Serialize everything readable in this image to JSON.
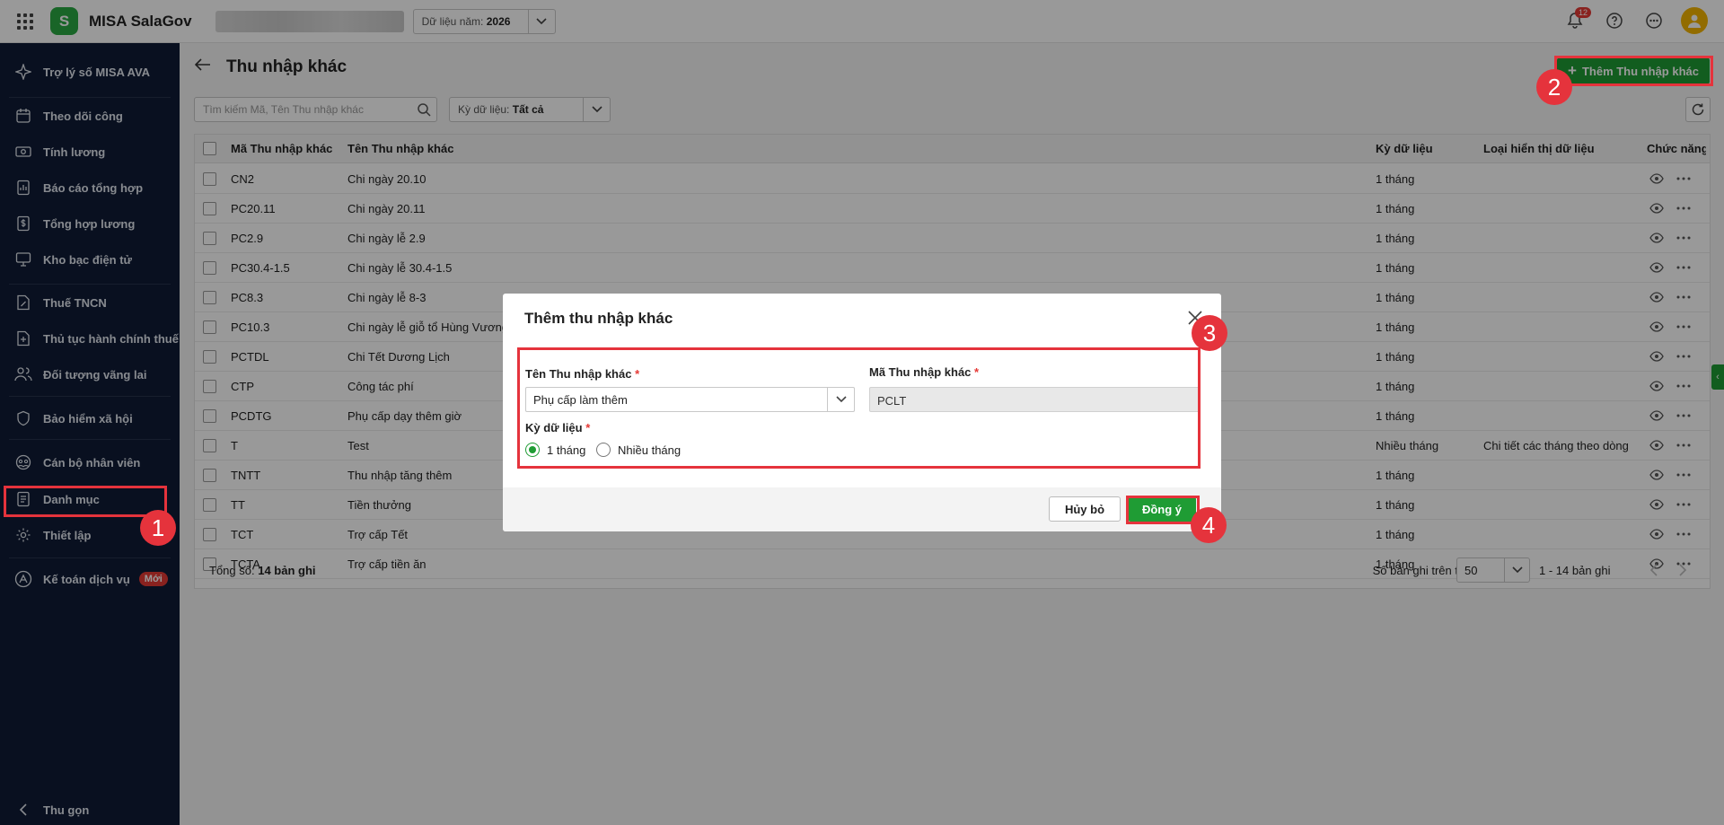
{
  "topbar": {
    "app_name": "MISA SalaGov",
    "logo_letter": "S",
    "year_label": "Dữ liệu năm:",
    "year_value": "2026",
    "notification_count": "12"
  },
  "sidebar": {
    "items": [
      {
        "label": "Trợ lý số MISA AVA",
        "icon": "sparkle-icon"
      },
      {
        "label": "Theo dõi công",
        "icon": "calendar-icon"
      },
      {
        "label": "Tính lương",
        "icon": "money-icon"
      },
      {
        "label": "Báo cáo tổng hợp",
        "icon": "report-icon"
      },
      {
        "label": "Tổng hợp lương",
        "icon": "salary-summary-icon"
      },
      {
        "label": "Kho bạc điện tử",
        "icon": "monitor-icon"
      },
      {
        "label": "Thuế TNCN",
        "icon": "tax-icon"
      },
      {
        "label": "Thủ tục hành chính thuế",
        "icon": "document-add-icon"
      },
      {
        "label": "Đối tượng vãng lai",
        "icon": "users-icon"
      },
      {
        "label": "Bảo hiểm xã hội",
        "icon": "shield-icon"
      },
      {
        "label": "Cán bộ nhân viên",
        "icon": "staff-icon"
      },
      {
        "label": "Danh mục",
        "icon": "list-icon"
      },
      {
        "label": "Thiết lập",
        "icon": "gear-icon"
      },
      {
        "label": "Kế toán dịch vụ",
        "icon": "accounting-icon"
      }
    ],
    "new_badge": "Mới",
    "collapse_label": "Thu gọn"
  },
  "page": {
    "title": "Thu nhập khác",
    "add_button": "Thêm Thu nhập khác",
    "search_placeholder": "Tìm kiếm Mã, Tên Thu nhập khác",
    "filter_label": "Kỳ dữ liệu:",
    "filter_value": "Tất cả"
  },
  "table": {
    "columns": [
      "Mã Thu nhập khác",
      "Tên Thu nhập khác",
      "Kỳ dữ liệu",
      "Loại hiển thị dữ liệu",
      "Chức năng"
    ],
    "rows": [
      {
        "code": "CN2",
        "name": "Chi ngày 20.10",
        "period": "1 tháng",
        "display": ""
      },
      {
        "code": "PC20.11",
        "name": "Chi ngày 20.11",
        "period": "1 tháng",
        "display": ""
      },
      {
        "code": "PC2.9",
        "name": "Chi ngày lễ 2.9",
        "period": "1 tháng",
        "display": ""
      },
      {
        "code": "PC30.4-1.5",
        "name": "Chi ngày lễ 30.4-1.5",
        "period": "1 tháng",
        "display": ""
      },
      {
        "code": "PC8.3",
        "name": "Chi ngày lễ 8-3",
        "period": "1 tháng",
        "display": ""
      },
      {
        "code": "PC10.3",
        "name": "Chi ngày lễ giỗ tổ Hùng Vương",
        "period": "1 tháng",
        "display": ""
      },
      {
        "code": "PCTDL",
        "name": "Chi Tết Dương Lịch",
        "period": "1 tháng",
        "display": ""
      },
      {
        "code": "CTP",
        "name": "Công tác phí",
        "period": "1 tháng",
        "display": ""
      },
      {
        "code": "PCDTG",
        "name": "Phụ cấp dạy thêm giờ",
        "period": "1 tháng",
        "display": ""
      },
      {
        "code": "T",
        "name": "Test",
        "period": "Nhiều tháng",
        "display": "Chi tiết các tháng theo dòng"
      },
      {
        "code": "TNTT",
        "name": "Thu nhập tăng thêm",
        "period": "1 tháng",
        "display": ""
      },
      {
        "code": "TT",
        "name": "Tiền thưởng",
        "period": "1 tháng",
        "display": ""
      },
      {
        "code": "TCT",
        "name": "Trợ cấp Tết",
        "period": "1 tháng",
        "display": ""
      },
      {
        "code": "TCTA",
        "name": "Trợ cấp tiền ăn",
        "period": "1 tháng",
        "display": ""
      }
    ],
    "total_label": "Tổng số:",
    "total_value": "14 bản ghi",
    "page_size_label": "Số bản ghi trên trang",
    "page_size": "50",
    "range": "1 - 14 bản ghi"
  },
  "modal": {
    "title": "Thêm thu nhập khác",
    "name_label": "Tên Thu nhập khác",
    "name_value": "Phụ cấp làm thêm",
    "code_label": "Mã Thu nhập khác",
    "code_value": "PCLT",
    "period_label": "Kỳ dữ liệu",
    "period_options": [
      "1 tháng",
      "Nhiều tháng"
    ],
    "selected_period": "1 tháng",
    "required_mark": "*",
    "cancel_button": "Hủy bỏ",
    "ok_button": "Đồng ý"
  },
  "annotations": {
    "steps": [
      "1",
      "2",
      "3",
      "4"
    ],
    "highlight_color": "#e5333c"
  },
  "colors": {
    "accent": "#1f9c34",
    "sidebar_bg": "#0f1b36"
  }
}
